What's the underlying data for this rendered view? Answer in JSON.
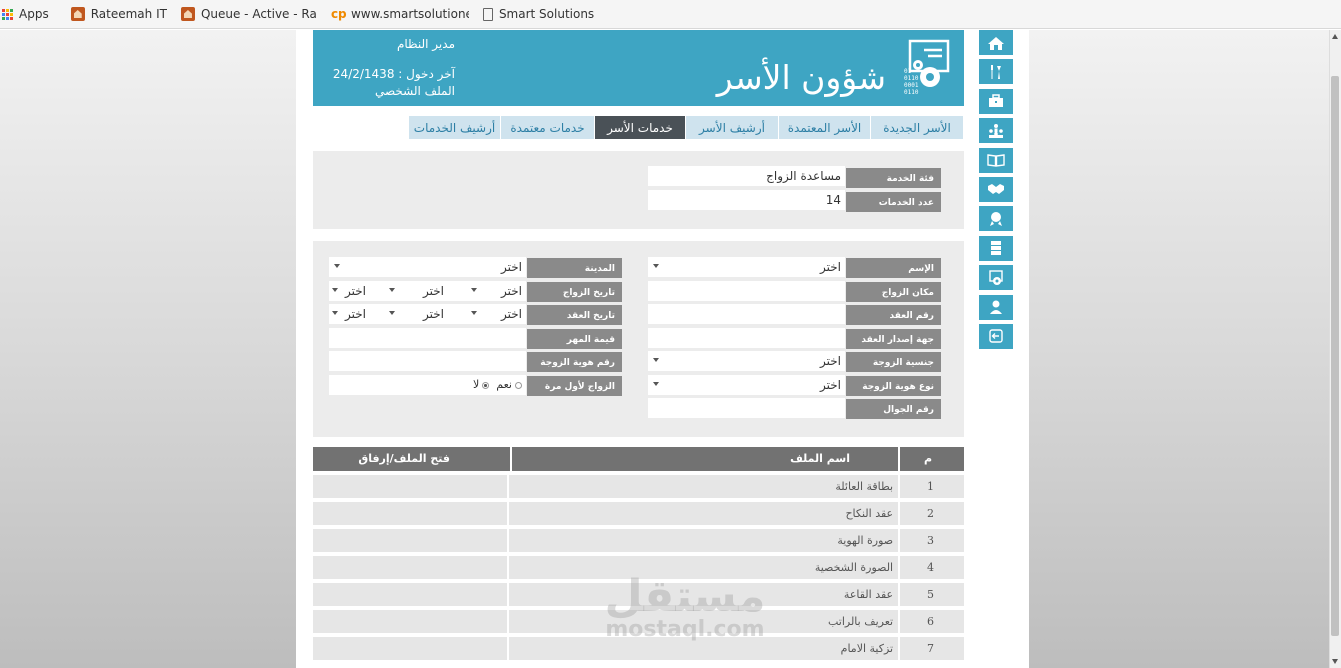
{
  "bookmarks": [
    {
      "label": "Apps",
      "icon": "apps-grid-icon"
    },
    {
      "label": "Rateemah IT",
      "icon": "house-icon"
    },
    {
      "label": "Queue - Active - Rate",
      "icon": "house-icon"
    },
    {
      "label": "www.smartsolutioneg",
      "icon": "cp-icon"
    },
    {
      "label": "Smart Solutions",
      "icon": "document-icon"
    }
  ],
  "header": {
    "title": "شؤون الأسر",
    "user_role": "مدير النظام",
    "last_login": "آخر دخول : 24/2/1438",
    "profile_link": "الملف الشخصي"
  },
  "tabs": [
    {
      "label": "الأسر الجديدة",
      "active": false
    },
    {
      "label": "الأسر المعتمدة",
      "active": false
    },
    {
      "label": "أرشيف الأسر",
      "active": false
    },
    {
      "label": "خدمات الأسر",
      "active": true
    },
    {
      "label": "خدمات معتمدة",
      "active": false
    },
    {
      "label": "أرشيف الخدمات",
      "active": false
    }
  ],
  "service": {
    "category_label": "فئة الخدمة",
    "category_value": "مساعدة الزواج",
    "count_label": "عدد الخدمات",
    "count_value": "14"
  },
  "form": {
    "name_label": "الإسم",
    "name_value": "اختر",
    "city_label": "المدينة",
    "city_value": "اختر",
    "marriage_place_label": "مكان الزواج",
    "marriage_date_label": "تاريخ الزواج",
    "marriage_date_parts": [
      "اختر",
      "اختر",
      "اختر"
    ],
    "contract_no_label": "رقم العقد",
    "contract_date_label": "تاريخ العقد",
    "contract_date_parts": [
      "اختر",
      "اختر",
      "اختر"
    ],
    "contract_issuer_label": "جهة إصدار العقد",
    "dowry_label": "قيمة المهر",
    "wife_nationality_label": "جنسية الزوجة",
    "wife_nationality_value": "اختر",
    "wife_id_no_label": "رقم هوية الزوجة",
    "wife_id_type_label": "نوع هوية الزوجة",
    "wife_id_type_value": "اختر",
    "first_marriage_label": "الزواج لأول مرة",
    "first_marriage_yes": "نعم",
    "first_marriage_no": "لا",
    "first_marriage_selected": "لا",
    "mobile_label": "رقم الجوال"
  },
  "table": {
    "col_num": "م",
    "col_name": "اسم الملف",
    "col_open": "فتح الملف/إرفاق",
    "rows": [
      {
        "num": "1",
        "name": "بطاقة العائلة"
      },
      {
        "num": "2",
        "name": "عقد النكاح"
      },
      {
        "num": "3",
        "name": "صورة الهوية"
      },
      {
        "num": "4",
        "name": "الصورة الشخصية"
      },
      {
        "num": "5",
        "name": "عقد القاعة"
      },
      {
        "num": "6",
        "name": "تعريف بالراتب"
      },
      {
        "num": "7",
        "name": "تزكية الامام"
      }
    ]
  },
  "watermark": {
    "arabic": "مستقل",
    "latin": "mostaql.com"
  },
  "side_nav": [
    "home-icon",
    "tools-icon",
    "briefcase-icon",
    "people-icon",
    "book-icon",
    "handshake-icon",
    "badge-icon",
    "server-icon",
    "report-gear-icon",
    "user-icon",
    "logout-icon"
  ],
  "colors": {
    "brand": "#3ea5c3",
    "tab_active": "#4a5157",
    "label_bg": "#8a8a8a",
    "table_head": "#727272"
  }
}
